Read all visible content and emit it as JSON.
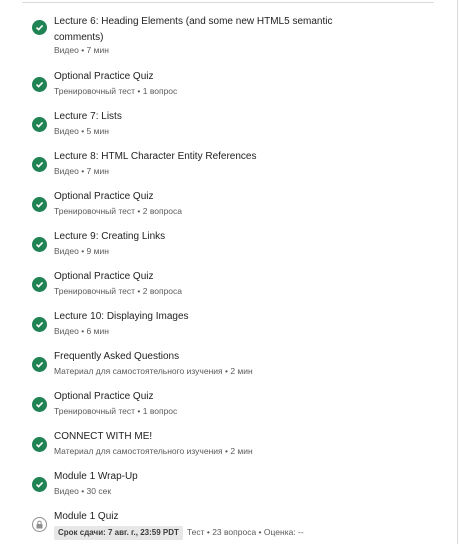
{
  "colors": {
    "done": "#1f8354",
    "locked_border": "#8f8f8f"
  },
  "items": [
    {
      "title": "Lecture 6: Heading Elements (and some new HTML5 semantic comments)",
      "meta": "Видео • 7 мин",
      "status": "check-icon"
    },
    {
      "title": "Optional Practice Quiz",
      "meta": "Тренировочный тест • 1 вопрос",
      "status": "check-icon"
    },
    {
      "title": "Lecture 7: Lists",
      "meta": "Видео • 5 мин",
      "status": "check-icon"
    },
    {
      "title": "Lecture 8: HTML Character Entity References",
      "meta": "Видео • 7 мин",
      "status": "check-icon"
    },
    {
      "title": "Optional Practice Quiz",
      "meta": "Тренировочный тест • 2 вопроса",
      "status": "check-icon"
    },
    {
      "title": "Lecture 9: Creating Links",
      "meta": "Видео • 9 мин",
      "status": "check-icon"
    },
    {
      "title": "Optional Practice Quiz",
      "meta": "Тренировочный тест • 2 вопроса",
      "status": "check-icon"
    },
    {
      "title": "Lecture 10: Displaying Images",
      "meta": "Видео • 6 мин",
      "status": "check-icon"
    },
    {
      "title": "Frequently Asked Questions",
      "meta": "Материал для самостоятельного изучения • 2 мин",
      "status": "check-icon"
    },
    {
      "title": "Optional Practice Quiz",
      "meta": "Тренировочный тест • 1 вопрос",
      "status": "check-icon"
    },
    {
      "title": "CONNECT WITH ME!",
      "meta": "Материал для самостоятельного изучения • 2 мин",
      "status": "check-icon"
    },
    {
      "title": "Module 1 Wrap-Up",
      "meta": "Видео • 30 сек",
      "status": "check-icon"
    }
  ],
  "quiz": {
    "title": "Module 1 Quiz",
    "due_badge": "Срок сдачи: 7 авг. г., 23:59 PDT",
    "meta": "Тест • 23 вопроса • Оценка: --",
    "status": "lock-icon"
  }
}
